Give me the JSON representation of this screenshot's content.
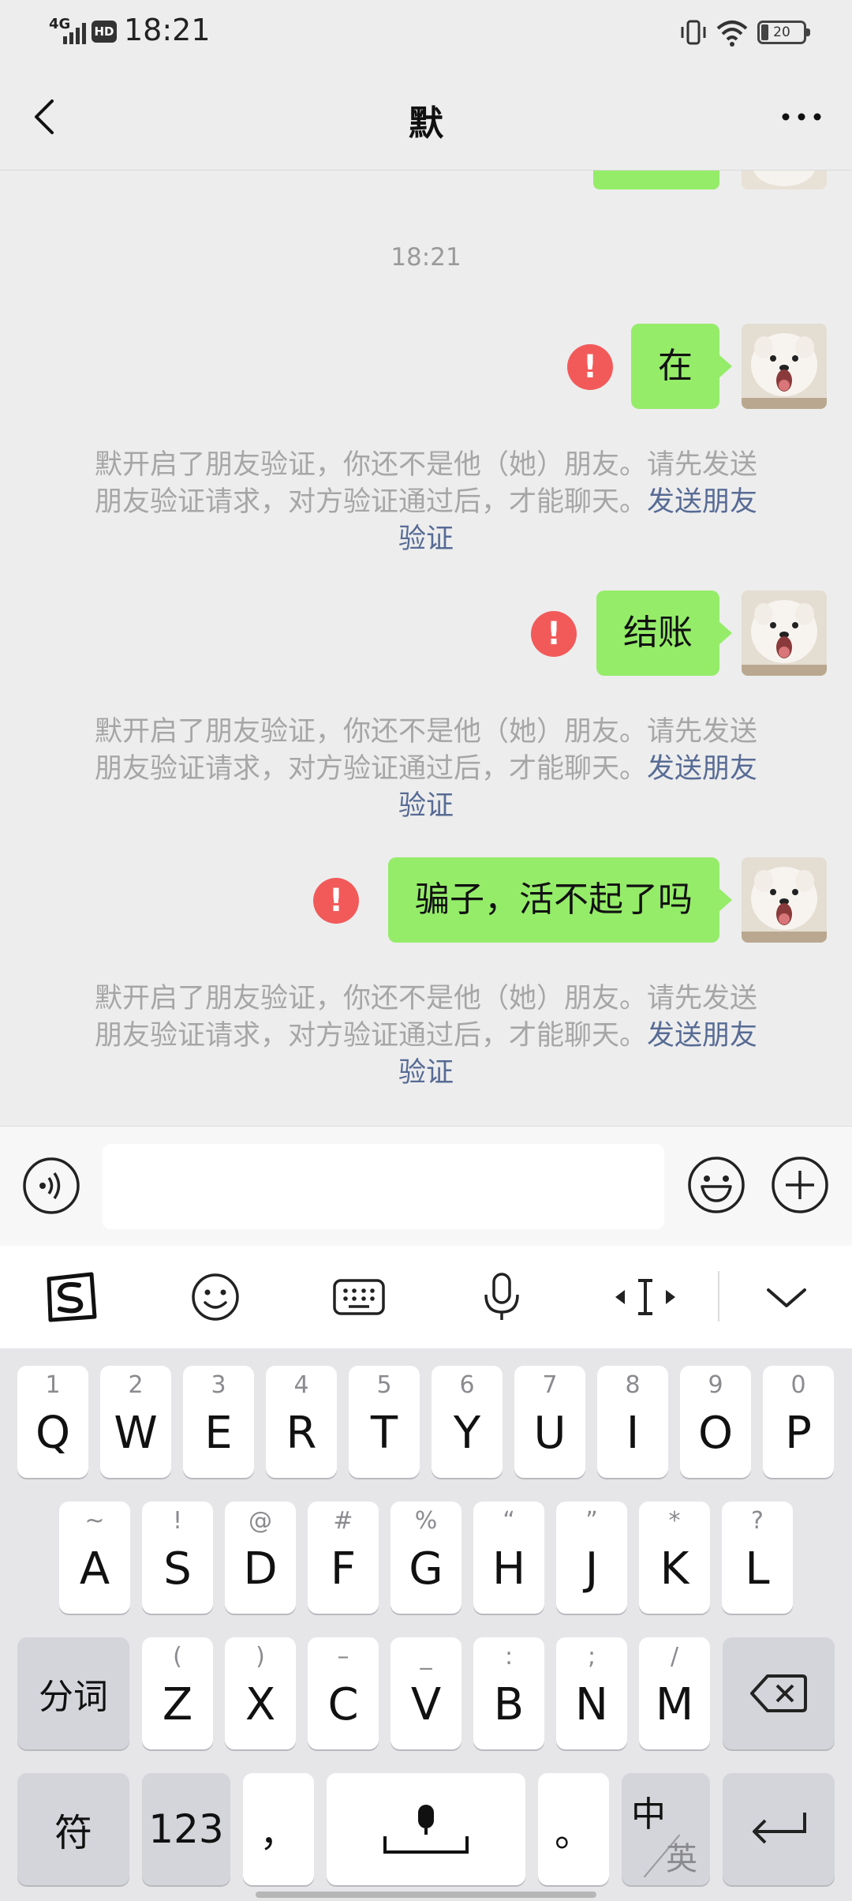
{
  "status_bar": {
    "network": "4G",
    "hd_badge": "HD",
    "time": "18:21",
    "battery": "20"
  },
  "nav": {
    "title": "默"
  },
  "chat": {
    "timestamp": "18:21",
    "messages": [
      {
        "text": "在"
      },
      {
        "text": "结账"
      },
      {
        "text": "骗子，活不起了吗"
      }
    ],
    "system_notice": {
      "line1": "默开启了朋友验证，你还不是他（她）朋友。请先发送",
      "line2": "朋友验证请求，对方验证通过后，才能聊天。",
      "link_part1": "发送朋友",
      "link_part2": "验证"
    }
  },
  "keyboard": {
    "row1": [
      {
        "hint": "1",
        "key": "Q"
      },
      {
        "hint": "2",
        "key": "W"
      },
      {
        "hint": "3",
        "key": "E"
      },
      {
        "hint": "4",
        "key": "R"
      },
      {
        "hint": "5",
        "key": "T"
      },
      {
        "hint": "6",
        "key": "Y"
      },
      {
        "hint": "7",
        "key": "U"
      },
      {
        "hint": "8",
        "key": "I"
      },
      {
        "hint": "9",
        "key": "O"
      },
      {
        "hint": "0",
        "key": "P"
      }
    ],
    "row2": [
      {
        "hint": "~",
        "key": "A"
      },
      {
        "hint": "!",
        "key": "S"
      },
      {
        "hint": "@",
        "key": "D"
      },
      {
        "hint": "#",
        "key": "F"
      },
      {
        "hint": "%",
        "key": "G"
      },
      {
        "hint": "“",
        "key": "H"
      },
      {
        "hint": "”",
        "key": "J"
      },
      {
        "hint": "*",
        "key": "K"
      },
      {
        "hint": "?",
        "key": "L"
      }
    ],
    "row3": [
      {
        "hint": "(",
        "key": "Z"
      },
      {
        "hint": ")",
        "key": "X"
      },
      {
        "hint": "–",
        "key": "C"
      },
      {
        "hint": "_",
        "key": "V"
      },
      {
        "hint": ":",
        "key": "B"
      },
      {
        "hint": ";",
        "key": "N"
      },
      {
        "hint": "/",
        "key": "M"
      }
    ],
    "fenci": "分词",
    "symbols": "符",
    "numbers": "123",
    "comma": "，",
    "period": "。",
    "lang_zh": "中",
    "lang_en": "英"
  }
}
